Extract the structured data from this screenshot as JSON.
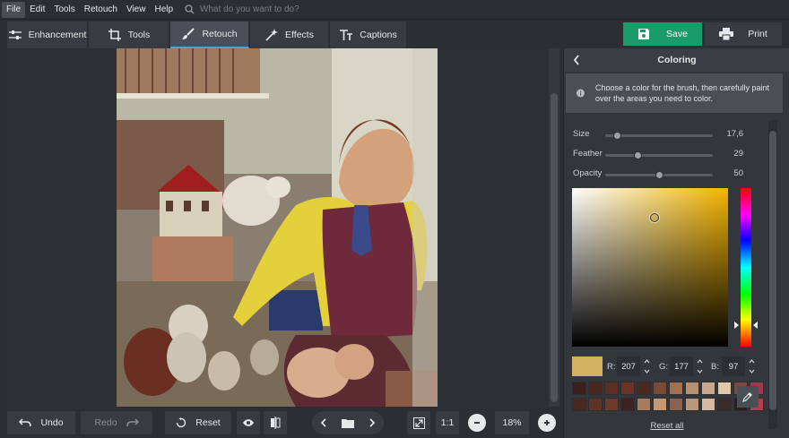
{
  "menu": {
    "items": [
      "File",
      "Edit",
      "Tools",
      "Retouch",
      "View",
      "Help"
    ],
    "search_placeholder": "What do you want to do?"
  },
  "tabs": [
    {
      "label": "Enhancement",
      "icon": "sliders-icon"
    },
    {
      "label": "Tools",
      "icon": "crop-icon"
    },
    {
      "label": "Retouch",
      "icon": "brush-icon",
      "active": true
    },
    {
      "label": "Effects",
      "icon": "effects-icon"
    },
    {
      "label": "Captions",
      "icon": "text-icon"
    }
  ],
  "actions": {
    "save": "Save",
    "print": "Print"
  },
  "panel": {
    "title": "Coloring",
    "info": "Choose a color for the brush, then carefully paint over the areas you need to color.",
    "sliders": [
      {
        "label": "Size",
        "value": "17,6",
        "level": 0.08
      },
      {
        "label": "Feather",
        "value": "29",
        "level": 0.29
      },
      {
        "label": "Opacity",
        "value": "50",
        "level": 0.5
      }
    ],
    "rgb": {
      "r_label": "R:",
      "r": "207",
      "g_label": "G:",
      "g": "177",
      "b_label": "B:",
      "b": "97"
    },
    "current_color": "#cfb161",
    "swatches": [
      "#3a1f1c",
      "#4a2620",
      "#5c2e24",
      "#6b3226",
      "#4a2a20",
      "#7a4a34",
      "#a07050",
      "#b89070",
      "#c8a888",
      "#e0c8a8",
      "#7a4a3a",
      "#9a3a4a",
      "#4a2822",
      "#5e3426",
      "#6e3a2a",
      "#3e2220",
      "#a87a5e",
      "#c89870",
      "#8a6250",
      "#b89878",
      "#d8b8a0",
      "#3a2a2a",
      "#2e1e1e",
      "#b04050"
    ],
    "reset_all": "Reset all"
  },
  "bottom": {
    "undo": "Undo",
    "redo": "Redo",
    "reset": "Reset",
    "one_to_one": "1:1",
    "zoom": "18%"
  },
  "colors": {
    "accent": "#4aa3df",
    "save": "#1a9c6a"
  }
}
